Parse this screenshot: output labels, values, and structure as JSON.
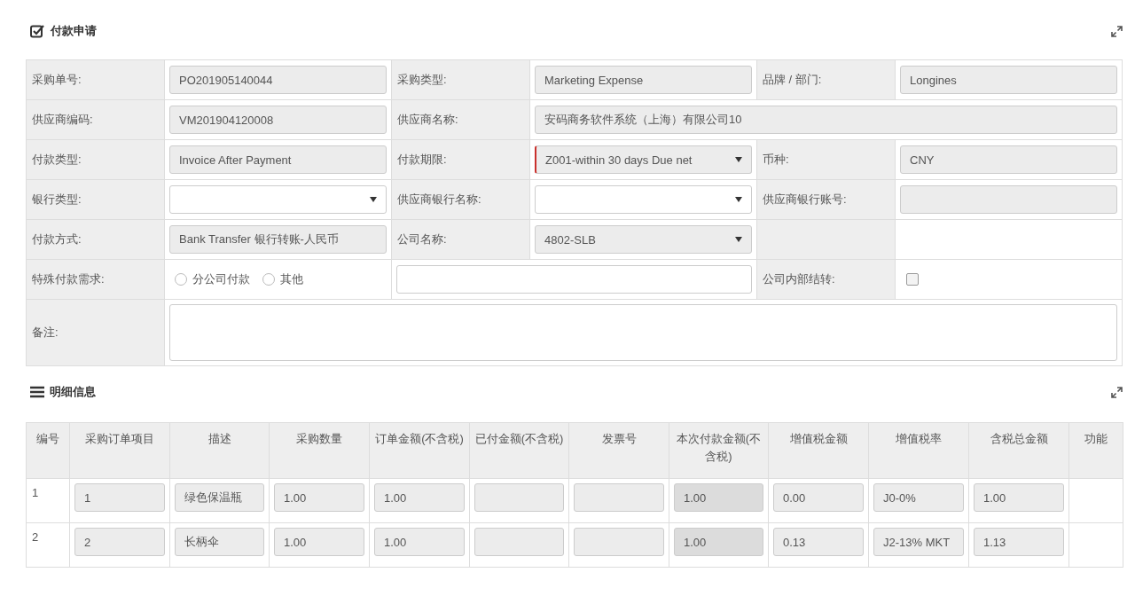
{
  "payment_section": {
    "title": "付款申请",
    "rows": [
      [
        {
          "kind": "label",
          "text": "采购单号:"
        },
        {
          "kind": "field",
          "value": "PO201905140044",
          "readonly": true
        },
        {
          "kind": "label",
          "text": "采购类型:"
        },
        {
          "kind": "field",
          "value": "Marketing Expense",
          "readonly": true
        },
        {
          "kind": "label",
          "text": "品牌 / 部门:"
        },
        {
          "kind": "field",
          "value": "Longines",
          "readonly": true
        }
      ],
      [
        {
          "kind": "label",
          "text": "供应商编码:"
        },
        {
          "kind": "field",
          "value": "VM201904120008",
          "readonly": true
        },
        {
          "kind": "label",
          "text": "供应商名称:"
        },
        {
          "kind": "field",
          "value": "安码商务软件系统（上海）有限公司10",
          "readonly": true,
          "colspan": 3
        }
      ],
      [
        {
          "kind": "label",
          "text": "付款类型:"
        },
        {
          "kind": "field",
          "value": "Invoice After Payment",
          "readonly": true
        },
        {
          "kind": "label",
          "text": "付款期限:"
        },
        {
          "kind": "select",
          "value": "Z001-within 30 days Due net",
          "disabled": true,
          "invalid": true
        },
        {
          "kind": "label",
          "text": "币种:"
        },
        {
          "kind": "field",
          "value": "CNY",
          "readonly": true
        }
      ],
      [
        {
          "kind": "label",
          "text": "银行类型:"
        },
        {
          "kind": "select",
          "disabled": false,
          "invalid": false
        },
        {
          "kind": "label",
          "text": "供应商银行名称:"
        },
        {
          "kind": "select",
          "disabled": false,
          "invalid": false
        },
        {
          "kind": "label",
          "text": "供应商银行账号:"
        },
        {
          "kind": "field",
          "readonly": true
        }
      ],
      [
        {
          "kind": "label",
          "text": "付款方式:"
        },
        {
          "kind": "field",
          "value": "Bank Transfer 银行转账-人民币",
          "readonly": true
        },
        {
          "kind": "label",
          "text": "公司名称:"
        },
        {
          "kind": "select",
          "value": "4802-SLB",
          "disabled": true,
          "invalid": false
        },
        {
          "kind": "blank-label"
        },
        {
          "kind": "blank"
        }
      ],
      [
        {
          "kind": "label",
          "text": "特殊付款需求:"
        },
        {
          "kind": "radios",
          "options": [
            {
              "label": "分公司付款",
              "selected": false
            },
            {
              "label": "其他",
              "selected": false
            }
          ]
        },
        {
          "kind": "field",
          "readonly": false,
          "colspan": 2
        },
        {
          "kind": "label",
          "text": "公司内部结转:"
        },
        {
          "kind": "checkbox",
          "checked": false
        }
      ],
      [
        {
          "kind": "label",
          "text": "备注:"
        },
        {
          "kind": "textarea",
          "readonly": false,
          "colspan": 5
        }
      ]
    ]
  },
  "detail_section": {
    "title": "明细信息",
    "columns": [
      "编号",
      "采购订单项目",
      "描述",
      "采购数量",
      "订单金额(不含税)",
      "已付金额(不含税)",
      "发票号",
      "本次付款金额(不含税)",
      "增值税金额",
      "增值税率",
      "含税总金额",
      "功能"
    ],
    "rows": [
      {
        "cells": [
          {
            "kind": "number",
            "value": "1"
          },
          {
            "kind": "input",
            "value": "1",
            "disabled": false
          },
          {
            "kind": "input",
            "value": "绿色保温瓶",
            "disabled": false
          },
          {
            "kind": "input",
            "value": "1.00",
            "disabled": false
          },
          {
            "kind": "input",
            "value": "1.00",
            "disabled": false
          },
          {
            "kind": "input",
            "disabled": false
          },
          {
            "kind": "input",
            "disabled": false
          },
          {
            "kind": "input",
            "value": "1.00",
            "disabled": true
          },
          {
            "kind": "input",
            "value": "0.00",
            "disabled": false
          },
          {
            "kind": "input",
            "value": "J0-0%",
            "disabled": false
          },
          {
            "kind": "input",
            "value": "1.00",
            "disabled": false
          },
          {
            "kind": "blank"
          }
        ]
      },
      {
        "cells": [
          {
            "kind": "number",
            "value": "2"
          },
          {
            "kind": "input",
            "value": "2",
            "disabled": false
          },
          {
            "kind": "input",
            "value": "长柄伞",
            "disabled": false
          },
          {
            "kind": "input",
            "value": "1.00",
            "disabled": false
          },
          {
            "kind": "input",
            "value": "1.00",
            "disabled": false
          },
          {
            "kind": "input",
            "disabled": false
          },
          {
            "kind": "input",
            "disabled": false
          },
          {
            "kind": "input",
            "value": "1.00",
            "disabled": true
          },
          {
            "kind": "input",
            "value": "0.13",
            "disabled": false
          },
          {
            "kind": "input",
            "value": "J2-13% MKT",
            "disabled": false
          },
          {
            "kind": "input",
            "value": "1.13",
            "disabled": false
          },
          {
            "kind": "blank"
          }
        ]
      }
    ]
  }
}
